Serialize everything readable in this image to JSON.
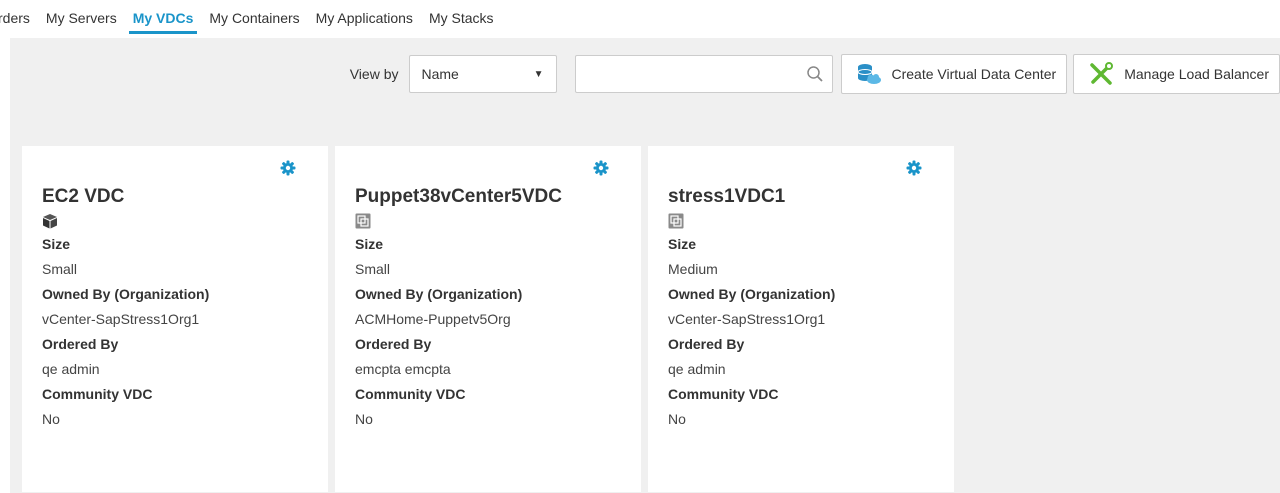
{
  "tabs": [
    {
      "label": "rders",
      "active": false
    },
    {
      "label": "My Servers",
      "active": false
    },
    {
      "label": "My VDCs",
      "active": true
    },
    {
      "label": "My Containers",
      "active": false
    },
    {
      "label": "My Applications",
      "active": false
    },
    {
      "label": "My Stacks",
      "active": false
    }
  ],
  "toolbar": {
    "view_by_label": "View by",
    "view_by_value": "Name",
    "search_value": "",
    "create_button_label": "Create Virtual Data Center",
    "manage_lb_button_label": "Manage Load Balancer"
  },
  "labels": {
    "size": "Size",
    "owned_by": "Owned By (Organization)",
    "ordered_by": "Ordered By",
    "community": "Community VDC"
  },
  "cards": [
    {
      "name": "EC2 VDC",
      "icon": "cube-icon",
      "size": "Small",
      "owned_by": "vCenter-SapStress1Org1",
      "ordered_by": "qe admin",
      "community": "No"
    },
    {
      "name": "Puppet38vCenter5VDC",
      "icon": "vcenter-icon",
      "size": "Small",
      "owned_by": "ACMHome-Puppetv5Org",
      "ordered_by": "emcpta emcpta",
      "community": "No"
    },
    {
      "name": "stress1VDC1",
      "icon": "vcenter-icon",
      "size": "Medium",
      "owned_by": "vCenter-SapStress1Org1",
      "ordered_by": "qe admin",
      "community": "No"
    }
  ],
  "colors": {
    "accent": "#1a94c9",
    "background": "#f0f0f0"
  }
}
